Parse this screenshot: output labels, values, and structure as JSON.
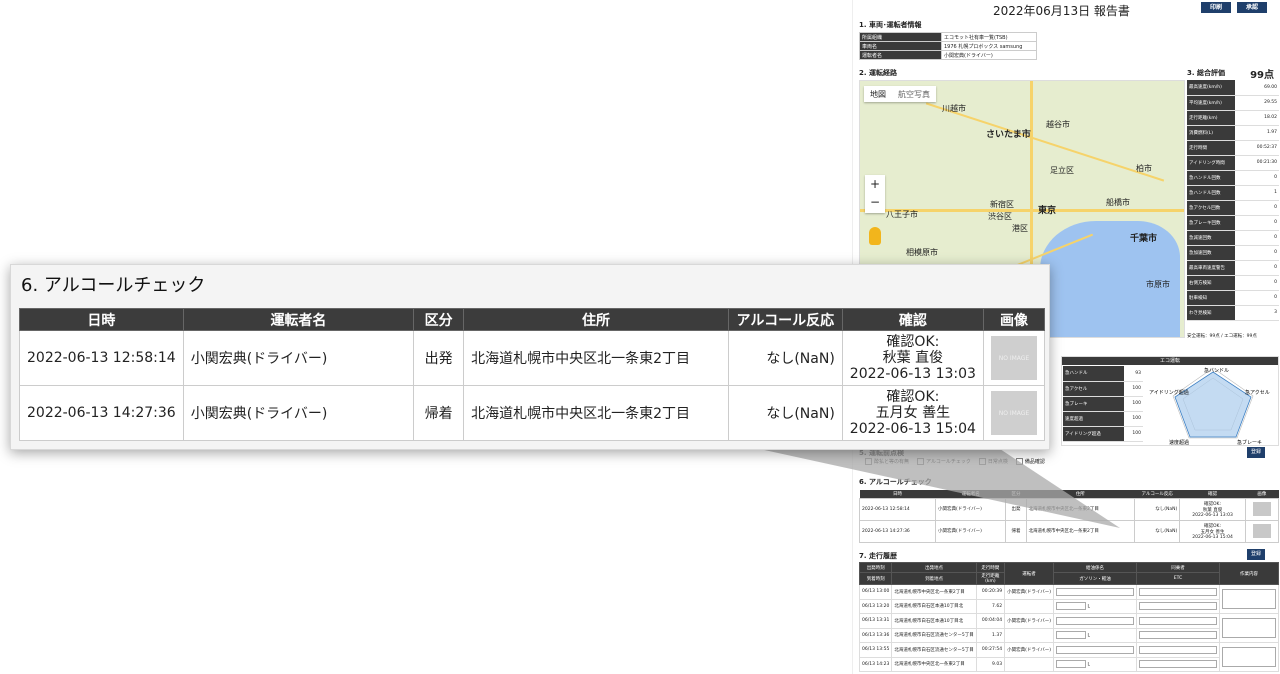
{
  "report": {
    "title": "2022年06月13日 報告書",
    "print_label": "印刷",
    "approve_label": "承認",
    "sec1": "1. 車両･運転者情報",
    "info": [
      {
        "label": "所属組織",
        "value": "エコモット社有車一覧(TSB)"
      },
      {
        "label": "車両名",
        "value": "1976 札幌プロボックス samsung"
      },
      {
        "label": "運転者名",
        "value": "小関宏典(ドライバー)"
      }
    ],
    "sec2": "2. 運転経路",
    "map": {
      "tab_map": "地図",
      "tab_photo": "航空写真",
      "zoom_in": "+",
      "zoom_out": "−",
      "cities": [
        "川越市",
        "越谷市",
        "さいたま市",
        "足立区",
        "柏市",
        "新宿区",
        "東京",
        "渋谷区",
        "港区",
        "船橋市",
        "八王子市",
        "千葉市",
        "相模原市",
        "市原市"
      ]
    },
    "sec3": "3. 総合評価",
    "total": "99点",
    "scores": [
      {
        "label": "最高速度(km/h)",
        "value": "69.00"
      },
      {
        "label": "平均速度(km/h)",
        "value": "29.55"
      },
      {
        "label": "走行距離(km)",
        "value": "18.02"
      },
      {
        "label": "消費燃料(L)",
        "value": "1.97"
      },
      {
        "label": "走行時間",
        "value": "00:52:37"
      },
      {
        "label": "アイドリング時間",
        "value": "00:21:30"
      },
      {
        "label": "急ハンドル回数",
        "value": "0"
      },
      {
        "label": "急ハンドル回数",
        "value": "1"
      },
      {
        "label": "急アクセル回数",
        "value": "0"
      },
      {
        "label": "急ブレーキ回数",
        "value": "0"
      },
      {
        "label": "急減速回数",
        "value": "0"
      },
      {
        "label": "急加速回数",
        "value": "0"
      },
      {
        "label": "最高車両速度警告",
        "value": "0"
      },
      {
        "label": "右側方検知",
        "value": "0"
      },
      {
        "label": "駐車検知",
        "value": "0"
      },
      {
        "label": "わき見検知",
        "value": "3"
      }
    ],
    "safety_line": "安全運転：99点 / エコ運転：99点",
    "eco_header": "エコ運転",
    "eco": [
      {
        "label": "急ハンドル",
        "value": "93"
      },
      {
        "label": "急アクセル",
        "value": "100"
      },
      {
        "label": "急ブレーキ",
        "value": "100"
      },
      {
        "label": "速度超過",
        "value": "100"
      },
      {
        "label": "アイドリング超過",
        "value": "100"
      }
    ],
    "radar_labels": [
      "急ハンドル",
      "急アクセル",
      "急ブレーキ",
      "速度超過",
      "アイドリング超過"
    ],
    "register_label": "登録",
    "sec5": "5. 運転前点検",
    "checks": [
      "酔払と等の有無",
      "アルコールチェック",
      "日常点検",
      "備品確認"
    ],
    "sec6": "6. アルコールチェック",
    "sec7": "7. 走行履歴",
    "hist_headers": {
      "depart_time": "出発時刻",
      "depart_place": "出発地点",
      "drive_time": "走行時間",
      "arrive_time": "到着時刻",
      "arrive_place": "到着地点",
      "distance": "走行距離(km)",
      "driver": "運転者",
      "fuel_title": "給油係名",
      "fuel_sub": "ガソリン・軽油",
      "toll_title": "同乗者",
      "toll_sub": "ETC",
      "memo": "作業内容"
    },
    "history": [
      {
        "time": "06/13 13:00",
        "place": "北海道札幌市中央区北一条東2丁目",
        "dur": "00:20:39",
        "driver": "小関宏典(ドライバー)"
      },
      {
        "time": "06/13 13:20",
        "place": "北海道札幌市白石区本通10丁目北",
        "dur": "7.62",
        "driver": ""
      },
      {
        "time": "06/13 13:31",
        "place": "北海道札幌市白石区本通10丁目北",
        "dur": "00:04:04",
        "driver": "小関宏典(ドライバー)"
      },
      {
        "time": "06/13 13:36",
        "place": "北海道札幌市白石区流通センター5丁目",
        "dur": "1.37",
        "driver": ""
      },
      {
        "time": "06/13 13:55",
        "place": "北海道札幌市白石区流通センター5丁目",
        "dur": "00:27:54",
        "driver": "小関宏典(ドライバー)"
      },
      {
        "time": "06/13 14:23",
        "place": "北海道札幌市中央区北一条東2丁目",
        "dur": "9.03",
        "driver": ""
      }
    ],
    "liter": "L"
  },
  "alcohol": {
    "title": "6. アルコールチェック",
    "headers": [
      "日時",
      "運転者名",
      "区分",
      "住所",
      "アルコール反応",
      "確認",
      "画像"
    ],
    "rows": [
      {
        "datetime": "2022-06-13 12:58:14",
        "driver": "小関宏典(ドライバー)",
        "kind": "出発",
        "address": "北海道札幌市中央区北一条東2丁目",
        "reaction": "なし(NaN)",
        "confirm1": "確認OK:",
        "confirm2": "秋葉 直俊",
        "confirm3": "2022-06-13 13:03",
        "image": "NO IMAGE"
      },
      {
        "datetime": "2022-06-13 14:27:36",
        "driver": "小関宏典(ドライバー)",
        "kind": "帰着",
        "address": "北海道札幌市中央区北一条東2丁目",
        "reaction": "なし(NaN)",
        "confirm1": "確認OK:",
        "confirm2": "五月女 善生",
        "confirm3": "2022-06-13 15:04",
        "image": "NO IMAGE"
      }
    ]
  }
}
